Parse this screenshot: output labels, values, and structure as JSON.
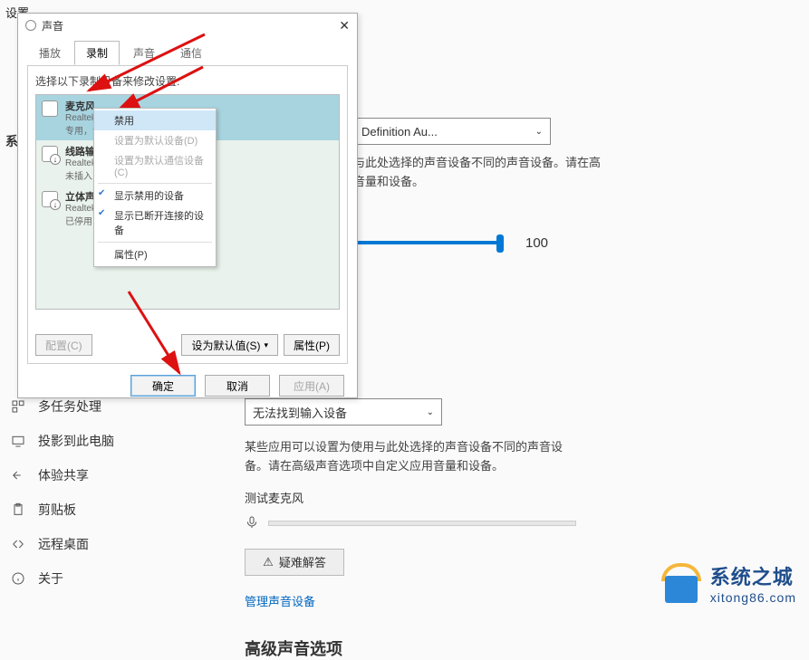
{
  "settings_title": "设置",
  "sys_label": "系",
  "sidebar": {
    "items": [
      {
        "label": ""
      },
      {
        "label": ""
      },
      {
        "label": ""
      },
      {
        "label": ""
      },
      {
        "label": ""
      },
      {
        "label": ""
      },
      {
        "label": ""
      },
      {
        "label": ""
      },
      {
        "label": ""
      },
      {
        "multitask": "多任务处理"
      },
      {
        "project": "投影到此电脑"
      },
      {
        "experience": "体验共享"
      },
      {
        "clipboard": "剪贴板"
      },
      {
        "remote": "远程桌面"
      },
      {
        "about": "关于"
      }
    ]
  },
  "content": {
    "output_device": "Definition Au...",
    "desc1a": "与此处选择的声音设备不同的声音设备。请在高",
    "desc1b": "音量和设备。",
    "slider_value": "100",
    "input_dd": "无法找到输入设备",
    "desc2": "某些应用可以设置为使用与此处选择的声音设备不同的声音设备。请在高级声音选项中自定义应用音量和设备。",
    "test_mic": "测试麦克风",
    "troubleshoot": "疑难解答",
    "manage_link": "管理声音设备",
    "advanced_header": "高级声音选项"
  },
  "dialog": {
    "title": "声音",
    "tabs": {
      "play": "播放",
      "record": "录制",
      "sound": "声音",
      "comm": "通信"
    },
    "instruction": "选择以下录制设备来修改设置:",
    "devices": [
      {
        "name": "麦克风",
        "sub": "Realtek High Definition Audio",
        "stat": "专用，设"
      },
      {
        "name": "线路输入",
        "sub": "Realtek",
        "stat": "未插入"
      },
      {
        "name": "立体声混",
        "sub": "Realtek",
        "stat": "已停用"
      }
    ],
    "btn_config": "配置(C)",
    "btn_default": "设为默认值(S)",
    "btn_props": "属性(P)",
    "btn_ok": "确定",
    "btn_cancel": "取消",
    "btn_apply": "应用(A)"
  },
  "context_menu": {
    "disable": "禁用",
    "set_default": "设置为默认设备(D)",
    "set_comm": "设置为默认通信设备(C)",
    "show_disabled": "显示禁用的设备",
    "show_disconnected": "显示已断开连接的设备",
    "properties": "属性(P)"
  },
  "watermark": {
    "big": "系统之城",
    "small": "xitong86.com"
  }
}
